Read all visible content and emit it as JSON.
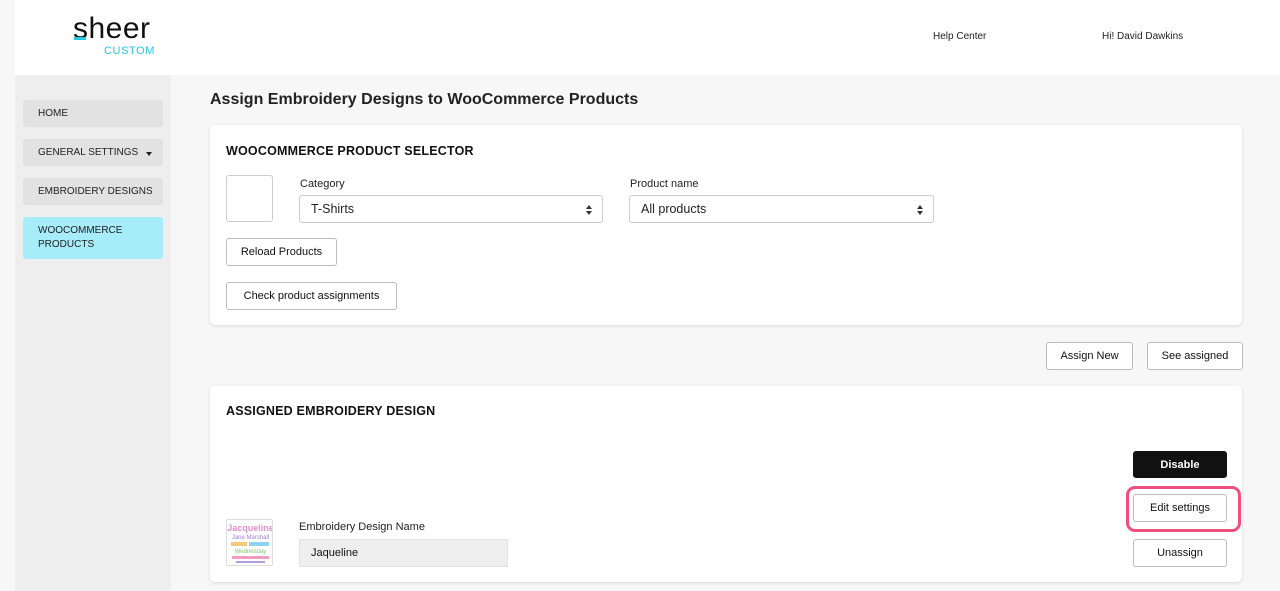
{
  "header": {
    "logo_main": "sheer",
    "logo_sub": "CUSTOM",
    "help_center": "Help Center",
    "greeting": "Hi! David Dawkins"
  },
  "sidebar": {
    "items": [
      {
        "label": "HOME"
      },
      {
        "label": "GENERAL SETTINGS"
      },
      {
        "label": "EMBROIDERY DESIGNS"
      },
      {
        "label": "WOOCOMMERCE PRODUCTS"
      }
    ],
    "active_index": 3
  },
  "main": {
    "page_title": "Assign Embroidery Designs to WooCommerce Products",
    "selector": {
      "title": "WOOCOMMERCE PRODUCT SELECTOR",
      "category_label": "Category",
      "category_value": "T-Shirts",
      "product_label": "Product name",
      "product_value": "All products",
      "reload_button": "Reload Products",
      "check_button": "Check product assignments"
    },
    "actions": {
      "assign_new": "Assign New",
      "see_assigned": "See assigned"
    },
    "assigned": {
      "title": "ASSIGNED EMBROIDERY DESIGN",
      "disable_button": "Disable",
      "edit_button": "Edit settings",
      "unassign_button": "Unassign",
      "design_name_label": "Embroidery Design Name",
      "design_name_value": "Jaqueline",
      "thumb_text": {
        "line1": "Jacqueline",
        "line2": "Jane Marshall",
        "line3": "Wednesday"
      }
    }
  },
  "colors": {
    "accent": "#2bc6e0",
    "active_nav": "#a6ecf9",
    "highlight": "#ef4f7e"
  }
}
